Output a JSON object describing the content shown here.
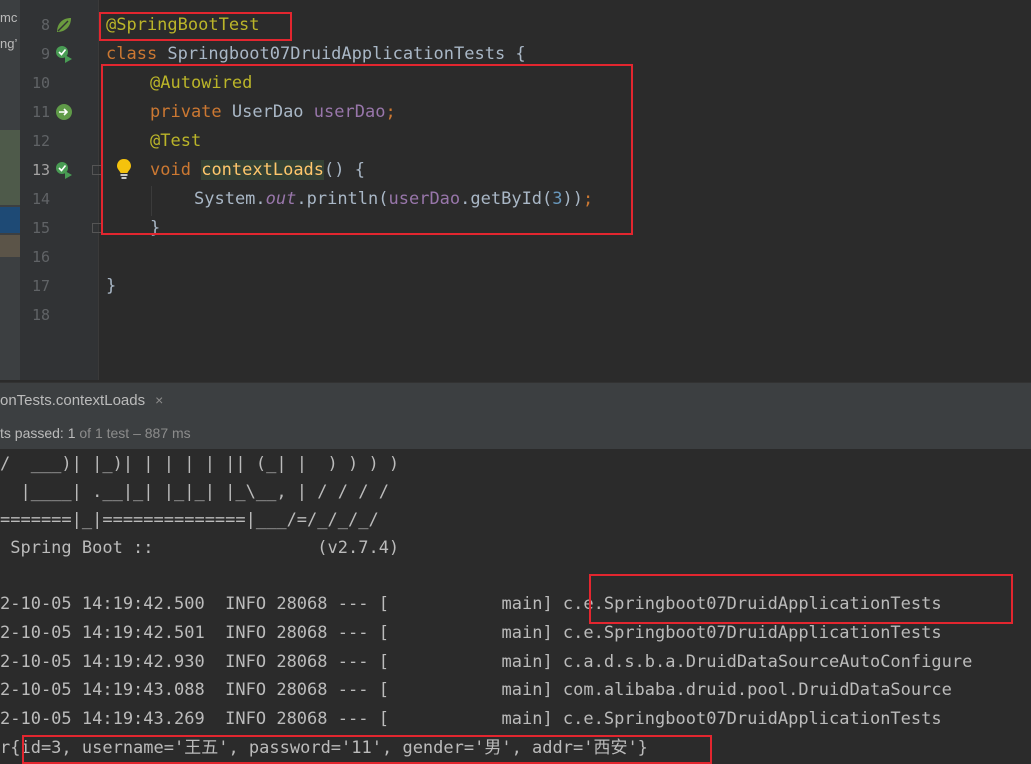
{
  "project_strip": {
    "fragments": [
      "mc",
      "ng’"
    ]
  },
  "gutter": {
    "line_numbers": [
      "8",
      "9",
      "10",
      "11",
      "12",
      "13",
      "14",
      "15",
      "16",
      "17",
      "18"
    ],
    "current_line": "13"
  },
  "editor": {
    "lines": {
      "l8_annotation": "@SpringBootTest",
      "l9_class_kw": "class",
      "l9_class_name": " Springboot07DruidApplicationTests {",
      "l10_annotation": "@Autowired",
      "l11_private": "private",
      "l11_type": " UserDao ",
      "l11_field": "userDao",
      "l11_semi": ";",
      "l12_annotation": "@Test",
      "l13_void": "void",
      "l13_method": "contextLoads",
      "l13_rest": "() {",
      "l14_system": "System.",
      "l14_out": "out",
      "l14_println": ".println(",
      "l14_field": "userDao",
      "l14_getbyid": ".getById(",
      "l14_num": "3",
      "l14_close": "))",
      "l14_semi": ";",
      "l15_brace": "}",
      "l17_brace": "}"
    },
    "colors": {
      "keyword": "#cc7832",
      "annotation": "#bbb529",
      "field": "#9876aa",
      "method": "#ffc66d",
      "number": "#6897bb",
      "text": "#a9b7c6",
      "highlight_box": "#e3262f"
    }
  },
  "run_panel": {
    "tab_label": "onTests.contextLoads",
    "tab_close_icon": "×",
    "status_prefix": "ts passed: ",
    "status_count": "1",
    "status_suffix": " of 1 test – 887 ms"
  },
  "console": {
    "banner": [
      "/  ___)| |_)| | | | | || (_| |  ) ) ) )",
      "  |____| .__|_| |_|_| |_\\__, | / / / /",
      "=======|_|==============|___/=/_/_/_/",
      " Spring Boot ::                (v2.7.4)"
    ],
    "log_lines": [
      "2-10-05 14:19:42.500  INFO 28068 --- [           main] c.e.Springboot07DruidApplicationTests",
      "2-10-05 14:19:42.501  INFO 28068 --- [           main] c.e.Springboot07DruidApplicationTests",
      "2-10-05 14:19:42.930  INFO 28068 --- [           main] c.a.d.s.b.a.DruidDataSourceAutoConfigure",
      "2-10-05 14:19:43.088  INFO 28068 --- [           main] com.alibaba.druid.pool.DruidDataSource",
      "2-10-05 14:19:43.269  INFO 28068 --- [           main] c.e.Springboot07DruidApplicationTests"
    ],
    "result_line": "r{id=3, username='王五', password='11', gender='男', addr='西安'}"
  },
  "icons": {
    "line8": "spring-leaf-icon",
    "line9": "run-test-class-icon",
    "line11": "autowired-bean-icon",
    "line13": "run-test-method-icon",
    "bulb": "intention-bulb-icon"
  }
}
